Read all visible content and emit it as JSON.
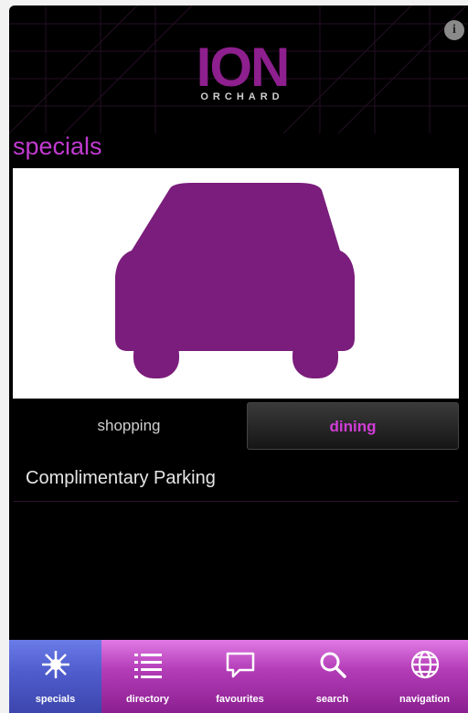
{
  "header": {
    "logo_main": "ION",
    "logo_sub": "ORCHARD",
    "info_label": "i"
  },
  "page": {
    "title": "specials"
  },
  "segments": [
    {
      "label": "shopping",
      "selected": false
    },
    {
      "label": "dining",
      "selected": true
    }
  ],
  "list": [
    {
      "label": "Complimentary Parking"
    }
  ],
  "tabbar": [
    {
      "label": "specials",
      "icon": "star-icon",
      "active": true
    },
    {
      "label": "directory",
      "icon": "list-icon",
      "active": false
    },
    {
      "label": "favourites",
      "icon": "chat-bubble-icon",
      "active": false
    },
    {
      "label": "search",
      "icon": "search-icon",
      "active": false
    },
    {
      "label": "navigation",
      "icon": "globe-icon",
      "active": false
    }
  ],
  "colors": {
    "accent": "#c13bd0",
    "brand_purple": "#7a1d7c",
    "active_tab": "#4f5ccc"
  }
}
